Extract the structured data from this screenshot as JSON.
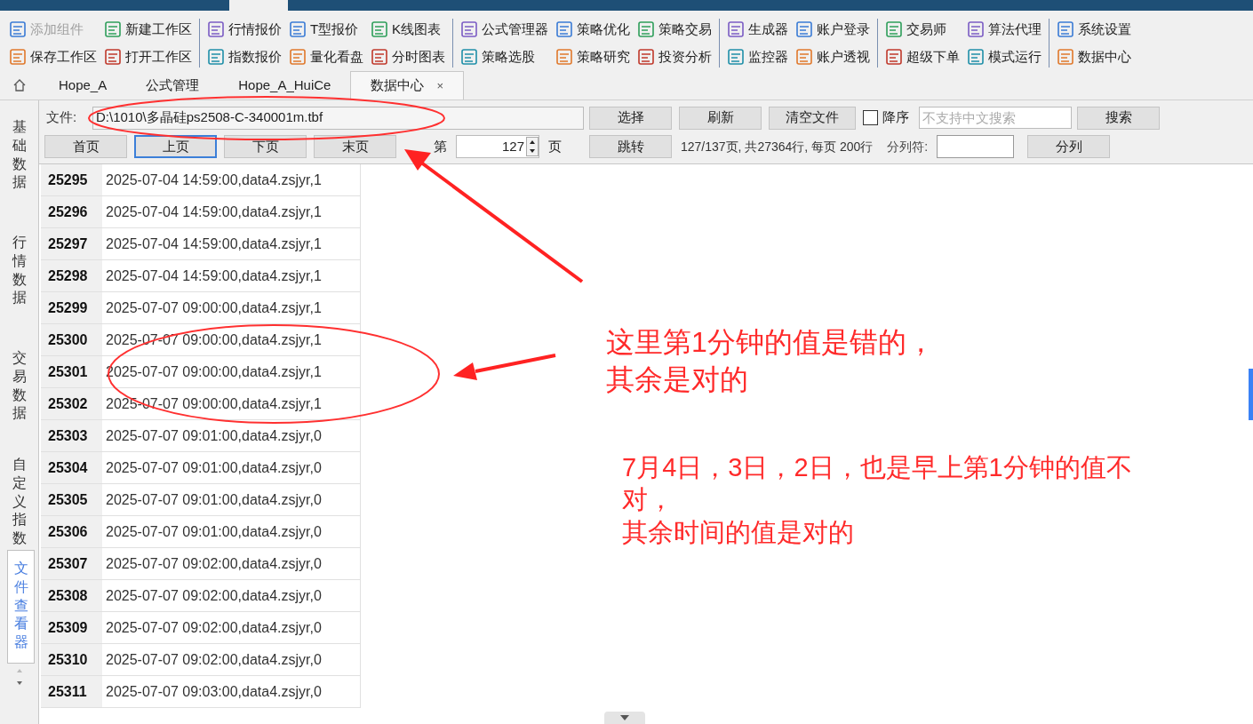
{
  "toolbar": {
    "groups": [
      {
        "columns": [
          [
            {
              "label": "添加组件",
              "disabled": true
            },
            {
              "label": "保存工作区",
              "disabled": false
            }
          ],
          [
            {
              "label": "新建工作区",
              "disabled": false
            },
            {
              "label": "打开工作区",
              "disabled": false
            }
          ]
        ]
      },
      {
        "columns": [
          [
            {
              "label": "行情报价",
              "disabled": false
            },
            {
              "label": "指数报价",
              "disabled": false
            }
          ],
          [
            {
              "label": "T型报价",
              "disabled": false
            },
            {
              "label": "量化看盘",
              "disabled": false
            }
          ],
          [
            {
              "label": "K线图表",
              "disabled": false
            },
            {
              "label": "分时图表",
              "disabled": false
            }
          ]
        ]
      },
      {
        "columns": [
          [
            {
              "label": "公式管理器",
              "disabled": false
            },
            {
              "label": "策略选股",
              "disabled": false
            }
          ],
          [
            {
              "label": "策略优化",
              "disabled": false
            },
            {
              "label": "策略研究",
              "disabled": false
            }
          ],
          [
            {
              "label": "策略交易",
              "disabled": false
            },
            {
              "label": "投资分析",
              "disabled": false
            }
          ]
        ]
      },
      {
        "columns": [
          [
            {
              "label": "生成器",
              "disabled": false
            },
            {
              "label": "监控器",
              "disabled": false
            }
          ],
          [
            {
              "label": "账户登录",
              "disabled": false
            },
            {
              "label": "账户透视",
              "disabled": false
            }
          ]
        ]
      },
      {
        "columns": [
          [
            {
              "label": "交易师",
              "disabled": false
            },
            {
              "label": "超级下单",
              "disabled": false
            }
          ],
          [
            {
              "label": "算法代理",
              "disabled": false
            },
            {
              "label": "模式运行",
              "disabled": false
            }
          ]
        ]
      },
      {
        "columns": [
          [
            {
              "label": "系统设置",
              "disabled": false
            },
            {
              "label": "数据中心",
              "disabled": false
            }
          ]
        ]
      }
    ]
  },
  "tabs": [
    {
      "label": "Hope_A",
      "selected": false
    },
    {
      "label": "公式管理",
      "selected": false
    },
    {
      "label": "Hope_A_HuiCe",
      "selected": false
    },
    {
      "label": "数据中心",
      "selected": true,
      "close": "×"
    }
  ],
  "side_tabs": [
    {
      "label": "基础数据",
      "selected": false
    },
    {
      "label": "行情数据",
      "selected": false
    },
    {
      "label": "交易数据",
      "selected": false
    },
    {
      "label": "自定义指数",
      "selected": false
    },
    {
      "label": "文件查看器",
      "selected": true
    }
  ],
  "file_row": {
    "label": "文件:",
    "path": "D:\\1010\\多晶硅ps2508-C-340001m.tbf",
    "buttons": [
      "选择",
      "刷新",
      "清空文件"
    ],
    "descending": {
      "label": "降序",
      "checked": false
    },
    "search": {
      "placeholder": "不支持中文搜索"
    },
    "search_button": "搜索"
  },
  "page_row": {
    "buttons": [
      {
        "label": "首页",
        "focused": false
      },
      {
        "label": "上页",
        "focused": true
      },
      {
        "label": "下页",
        "focused": false
      },
      {
        "label": "末页",
        "focused": false
      }
    ],
    "page_prefix": "第",
    "page": "127",
    "page_suffix": "页",
    "jump_button": "跳转",
    "info": "127/137页, 共27364行, 每页 200行",
    "separator_label": "分列符:",
    "split_button": "分列"
  },
  "rows": [
    {
      "index": "25295",
      "text": "2025-07-04 14:59:00,data4.zsjyr,1"
    },
    {
      "index": "25296",
      "text": "2025-07-04 14:59:00,data4.zsjyr,1"
    },
    {
      "index": "25297",
      "text": "2025-07-04 14:59:00,data4.zsjyr,1"
    },
    {
      "index": "25298",
      "text": "2025-07-04 14:59:00,data4.zsjyr,1"
    },
    {
      "index": "25299",
      "text": "2025-07-07 09:00:00,data4.zsjyr,1"
    },
    {
      "index": "25300",
      "text": "2025-07-07 09:00:00,data4.zsjyr,1"
    },
    {
      "index": "25301",
      "text": "2025-07-07 09:00:00,data4.zsjyr,1"
    },
    {
      "index": "25302",
      "text": "2025-07-07 09:00:00,data4.zsjyr,1"
    },
    {
      "index": "25303",
      "text": "2025-07-07 09:01:00,data4.zsjyr,0"
    },
    {
      "index": "25304",
      "text": "2025-07-07 09:01:00,data4.zsjyr,0"
    },
    {
      "index": "25305",
      "text": "2025-07-07 09:01:00,data4.zsjyr,0"
    },
    {
      "index": "25306",
      "text": "2025-07-07 09:01:00,data4.zsjyr,0"
    },
    {
      "index": "25307",
      "text": "2025-07-07 09:02:00,data4.zsjyr,0"
    },
    {
      "index": "25308",
      "text": "2025-07-07 09:02:00,data4.zsjyr,0"
    },
    {
      "index": "25309",
      "text": "2025-07-07 09:02:00,data4.zsjyr,0"
    },
    {
      "index": "25310",
      "text": "2025-07-07 09:02:00,data4.zsjyr,0"
    },
    {
      "index": "25311",
      "text": "2025-07-07 09:03:00,data4.zsjyr,0"
    }
  ],
  "annotations": [
    {
      "lines": [
        "这里第1分钟的值是错的，",
        "其余是对的"
      ]
    },
    {
      "lines": [
        "7月4日，3日，2日，也是早上第1分钟的值不对，",
        "其余时间的值是对的"
      ]
    }
  ]
}
